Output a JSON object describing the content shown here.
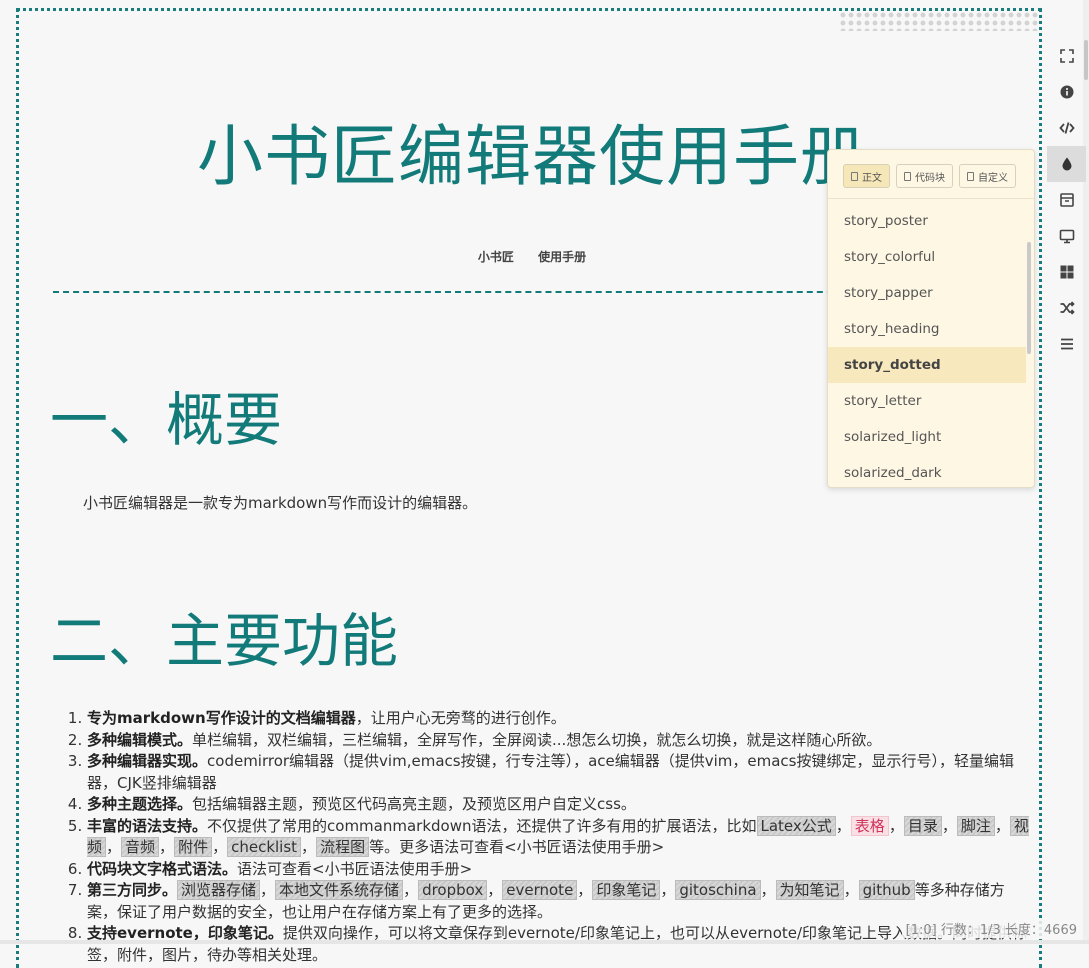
{
  "document": {
    "title": "小书匠编辑器使用手册",
    "subtitle": [
      "小书匠",
      "使用手册"
    ],
    "section1": {
      "heading": "一、概要",
      "intro": "小书匠编辑器是一款专为markdown写作而设计的编辑器。"
    },
    "section2": {
      "heading": "二、主要功能"
    },
    "features": [
      {
        "bold": "专为markdown写作设计的文档编辑器",
        "text": "，让用户心无旁骛的进行创作。"
      },
      {
        "bold": "多种编辑模式。",
        "text": "单栏编辑，双栏编辑，三栏编辑，全屏写作，全屏阅读...想怎么切换，就怎么切换，就是这样随心所欲。"
      },
      {
        "bold": "多种编辑器实现。",
        "text": "codemirror编辑器（提供vim,emacs按键，行专注等），ace编辑器（提供vim，emacs按键绑定，显示行号），轻量编辑器，CJK竖排编辑器"
      },
      {
        "bold": "多种主题选择。",
        "text": "包括编辑器主题，预览区代码高亮主题，及预览区用户自定义css。"
      },
      {
        "bold": "丰富的语法支持。",
        "text": "不仅提供了常用的commanmarkdown语法，还提供了许多有用的扩展语法，比如",
        "tags": [
          "Latex公式",
          "表格",
          "目录",
          "脚注",
          "视频",
          "音频",
          "附件",
          "checklist",
          "流程图"
        ],
        "tail": "等。更多语法可查看<小书匠语法使用手册>"
      },
      {
        "bold": "代码块文字格式语法。",
        "text": "语法可查看<小书匠语法使用手册>"
      },
      {
        "bold": "第三方同步。",
        "tags": [
          "浏览器存储",
          "本地文件系统存储",
          "dropbox",
          "evernote",
          "印象笔记",
          "gitoschina",
          "为知笔记",
          "github"
        ],
        "tail": "等多种存储方案，保证了用户数据的安全，也让用户在存储方案上有了更多的选择。"
      },
      {
        "bold": "支持evernote，印象笔记。",
        "text": "提供双向操作，可以将文章保存到evernote/印象笔记上，也可以从evernote/印象笔记上导入数据。同时提供标签，附件，图片，待办等相关处理。"
      }
    ]
  },
  "status_bar": {
    "text": "[1:0] 行数：1/3 长度：4669"
  },
  "toolbar": {
    "items": [
      {
        "name": "fullscreen-icon"
      },
      {
        "name": "info-icon"
      },
      {
        "name": "code-icon"
      },
      {
        "name": "theme-drop-icon",
        "active": true
      },
      {
        "name": "archive-icon"
      },
      {
        "name": "monitor-icon"
      },
      {
        "name": "grid-icon"
      },
      {
        "name": "shuffle-icon"
      },
      {
        "name": "menu-icon"
      }
    ]
  },
  "theme_popup": {
    "tabs": [
      "正文",
      "代码块",
      "自定义"
    ],
    "active_tab": 0,
    "themes": [
      "story_poster",
      "story_colorful",
      "story_papper",
      "story_heading",
      "story_dotted",
      "story_letter",
      "solarized_light",
      "solarized_dark"
    ],
    "selected": "story_dotted"
  },
  "colors": {
    "accent": "#137a7a",
    "popup_bg": "#fdf7e4",
    "selected_bg": "#f8e8bd"
  }
}
